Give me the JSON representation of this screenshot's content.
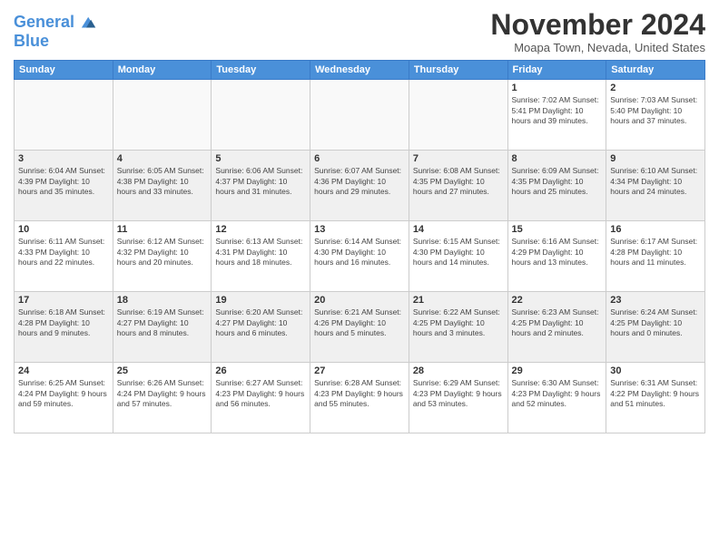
{
  "header": {
    "logo_line1": "General",
    "logo_line2": "Blue",
    "month_title": "November 2024",
    "location": "Moapa Town, Nevada, United States"
  },
  "weekdays": [
    "Sunday",
    "Monday",
    "Tuesday",
    "Wednesday",
    "Thursday",
    "Friday",
    "Saturday"
  ],
  "weeks": [
    [
      {
        "day": "",
        "info": ""
      },
      {
        "day": "",
        "info": ""
      },
      {
        "day": "",
        "info": ""
      },
      {
        "day": "",
        "info": ""
      },
      {
        "day": "",
        "info": ""
      },
      {
        "day": "1",
        "info": "Sunrise: 7:02 AM\nSunset: 5:41 PM\nDaylight: 10 hours\nand 39 minutes."
      },
      {
        "day": "2",
        "info": "Sunrise: 7:03 AM\nSunset: 5:40 PM\nDaylight: 10 hours\nand 37 minutes."
      }
    ],
    [
      {
        "day": "3",
        "info": "Sunrise: 6:04 AM\nSunset: 4:39 PM\nDaylight: 10 hours\nand 35 minutes."
      },
      {
        "day": "4",
        "info": "Sunrise: 6:05 AM\nSunset: 4:38 PM\nDaylight: 10 hours\nand 33 minutes."
      },
      {
        "day": "5",
        "info": "Sunrise: 6:06 AM\nSunset: 4:37 PM\nDaylight: 10 hours\nand 31 minutes."
      },
      {
        "day": "6",
        "info": "Sunrise: 6:07 AM\nSunset: 4:36 PM\nDaylight: 10 hours\nand 29 minutes."
      },
      {
        "day": "7",
        "info": "Sunrise: 6:08 AM\nSunset: 4:35 PM\nDaylight: 10 hours\nand 27 minutes."
      },
      {
        "day": "8",
        "info": "Sunrise: 6:09 AM\nSunset: 4:35 PM\nDaylight: 10 hours\nand 25 minutes."
      },
      {
        "day": "9",
        "info": "Sunrise: 6:10 AM\nSunset: 4:34 PM\nDaylight: 10 hours\nand 24 minutes."
      }
    ],
    [
      {
        "day": "10",
        "info": "Sunrise: 6:11 AM\nSunset: 4:33 PM\nDaylight: 10 hours\nand 22 minutes."
      },
      {
        "day": "11",
        "info": "Sunrise: 6:12 AM\nSunset: 4:32 PM\nDaylight: 10 hours\nand 20 minutes."
      },
      {
        "day": "12",
        "info": "Sunrise: 6:13 AM\nSunset: 4:31 PM\nDaylight: 10 hours\nand 18 minutes."
      },
      {
        "day": "13",
        "info": "Sunrise: 6:14 AM\nSunset: 4:30 PM\nDaylight: 10 hours\nand 16 minutes."
      },
      {
        "day": "14",
        "info": "Sunrise: 6:15 AM\nSunset: 4:30 PM\nDaylight: 10 hours\nand 14 minutes."
      },
      {
        "day": "15",
        "info": "Sunrise: 6:16 AM\nSunset: 4:29 PM\nDaylight: 10 hours\nand 13 minutes."
      },
      {
        "day": "16",
        "info": "Sunrise: 6:17 AM\nSunset: 4:28 PM\nDaylight: 10 hours\nand 11 minutes."
      }
    ],
    [
      {
        "day": "17",
        "info": "Sunrise: 6:18 AM\nSunset: 4:28 PM\nDaylight: 10 hours\nand 9 minutes."
      },
      {
        "day": "18",
        "info": "Sunrise: 6:19 AM\nSunset: 4:27 PM\nDaylight: 10 hours\nand 8 minutes."
      },
      {
        "day": "19",
        "info": "Sunrise: 6:20 AM\nSunset: 4:27 PM\nDaylight: 10 hours\nand 6 minutes."
      },
      {
        "day": "20",
        "info": "Sunrise: 6:21 AM\nSunset: 4:26 PM\nDaylight: 10 hours\nand 5 minutes."
      },
      {
        "day": "21",
        "info": "Sunrise: 6:22 AM\nSunset: 4:25 PM\nDaylight: 10 hours\nand 3 minutes."
      },
      {
        "day": "22",
        "info": "Sunrise: 6:23 AM\nSunset: 4:25 PM\nDaylight: 10 hours\nand 2 minutes."
      },
      {
        "day": "23",
        "info": "Sunrise: 6:24 AM\nSunset: 4:25 PM\nDaylight: 10 hours\nand 0 minutes."
      }
    ],
    [
      {
        "day": "24",
        "info": "Sunrise: 6:25 AM\nSunset: 4:24 PM\nDaylight: 9 hours\nand 59 minutes."
      },
      {
        "day": "25",
        "info": "Sunrise: 6:26 AM\nSunset: 4:24 PM\nDaylight: 9 hours\nand 57 minutes."
      },
      {
        "day": "26",
        "info": "Sunrise: 6:27 AM\nSunset: 4:23 PM\nDaylight: 9 hours\nand 56 minutes."
      },
      {
        "day": "27",
        "info": "Sunrise: 6:28 AM\nSunset: 4:23 PM\nDaylight: 9 hours\nand 55 minutes."
      },
      {
        "day": "28",
        "info": "Sunrise: 6:29 AM\nSunset: 4:23 PM\nDaylight: 9 hours\nand 53 minutes."
      },
      {
        "day": "29",
        "info": "Sunrise: 6:30 AM\nSunset: 4:23 PM\nDaylight: 9 hours\nand 52 minutes."
      },
      {
        "day": "30",
        "info": "Sunrise: 6:31 AM\nSunset: 4:22 PM\nDaylight: 9 hours\nand 51 minutes."
      }
    ]
  ]
}
